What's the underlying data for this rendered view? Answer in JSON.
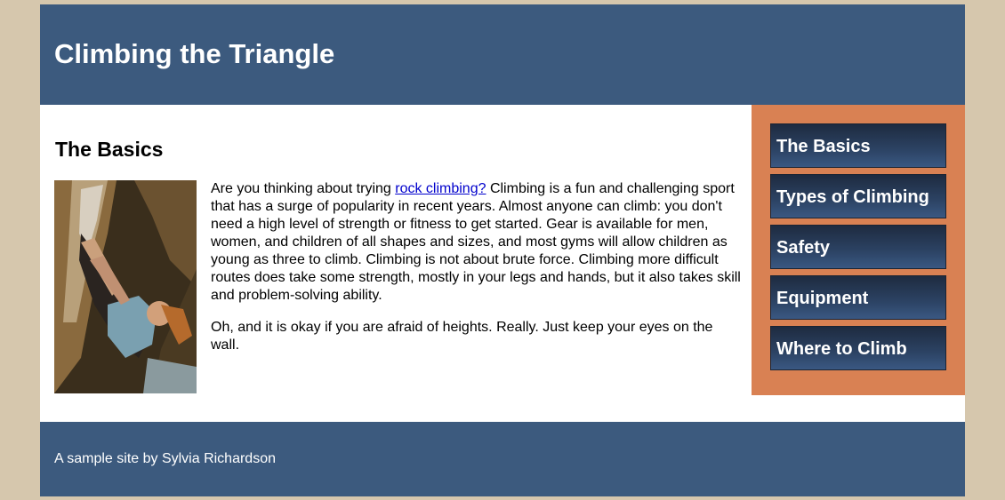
{
  "header": {
    "title": "Climbing the Triangle"
  },
  "main": {
    "heading": "The Basics",
    "image_alt": "rock climber photo",
    "paragraph1_before_link": "Are you thinking about trying ",
    "paragraph1_link": "rock climbing?",
    "paragraph1_after_link": " Climbing is a fun and challenging sport that has a surge of popularity in recent years. Almost anyone can climb: you don't need a high level of strength or fitness to get started. Gear is available for men, women, and children of all shapes and sizes, and most gyms will allow children as young as three to climb. Climbing is not about brute force. Climbing more difficult routes does take some strength, mostly in your legs and hands, but it also takes skill and problem-solving ability.",
    "paragraph2": "Oh, and it is okay if you are afraid of heights. Really. Just keep your eyes on the wall."
  },
  "sidebar": {
    "items": [
      {
        "label": "The Basics"
      },
      {
        "label": "Types of Climbing"
      },
      {
        "label": "Safety"
      },
      {
        "label": "Equipment"
      },
      {
        "label": "Where to Climb"
      }
    ]
  },
  "footer": {
    "text": "A sample site by Sylvia Richardson"
  },
  "colors": {
    "background": "#d6c7ad",
    "header_bg": "#3c5a7e",
    "sidebar_bg": "#d98153",
    "nav_button_bg": "#2c4364"
  }
}
